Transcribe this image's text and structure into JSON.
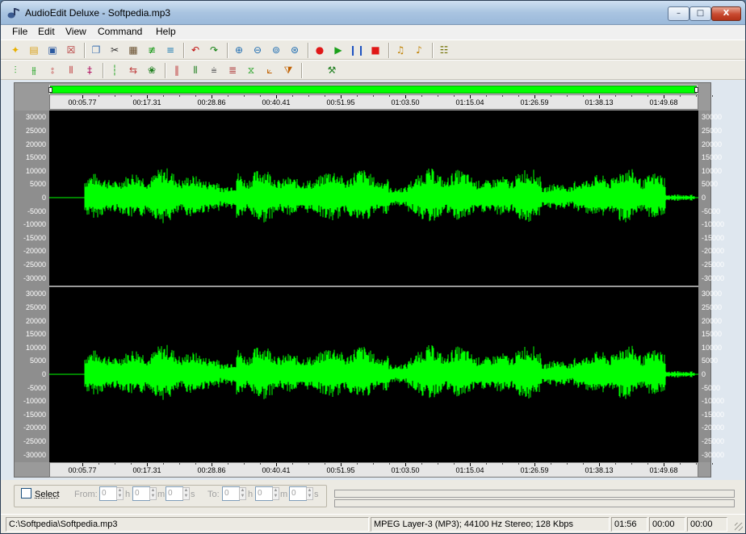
{
  "window": {
    "title": "AudioEdit Deluxe  -  Softpedia.mp3",
    "controls": {
      "minimize": "–",
      "maximize": "□",
      "close": "X"
    }
  },
  "menubar": [
    "File",
    "Edit",
    "View",
    "Command",
    "Help"
  ],
  "toolbar_main": [
    {
      "name": "new-file-icon",
      "glyph": "✦",
      "color": "#e8b000"
    },
    {
      "name": "open-file-icon",
      "glyph": "▤",
      "color": "#d9a21b"
    },
    {
      "name": "save-icon",
      "glyph": "▣",
      "color": "#2c5aa0"
    },
    {
      "name": "close-file-icon",
      "glyph": "☒",
      "color": "#b02a2a"
    },
    {
      "name": "copy-icon",
      "glyph": "❐",
      "color": "#3a6fb0"
    },
    {
      "name": "cut-icon",
      "glyph": "✂",
      "color": "#333333"
    },
    {
      "name": "paste-icon",
      "glyph": "▦",
      "color": "#6a5030"
    },
    {
      "name": "trim-icon",
      "glyph": "≢",
      "color": "#1a9a1a"
    },
    {
      "name": "mix-icon",
      "glyph": "≡",
      "color": "#1a7ab0"
    },
    {
      "name": "undo-icon",
      "glyph": "↶",
      "color": "#c01010"
    },
    {
      "name": "redo-icon",
      "glyph": "↷",
      "color": "#108010"
    },
    {
      "name": "zoom-in-icon",
      "glyph": "⊕",
      "color": "#1a6ab0"
    },
    {
      "name": "zoom-out-icon",
      "glyph": "⊖",
      "color": "#1a6ab0"
    },
    {
      "name": "zoom-selection-icon",
      "glyph": "⊚",
      "color": "#1a6ab0"
    },
    {
      "name": "zoom-all-icon",
      "glyph": "⊛",
      "color": "#1a6ab0"
    },
    {
      "name": "record-icon",
      "glyph": "●",
      "color": "#e01818"
    },
    {
      "name": "play-icon",
      "glyph": "▶",
      "color": "#1aa01a"
    },
    {
      "name": "pause-icon",
      "glyph": "❙❙",
      "color": "#1a50c0"
    },
    {
      "name": "stop-icon",
      "glyph": "■",
      "color": "#e01818"
    },
    {
      "name": "volume-icon",
      "glyph": "♫",
      "color": "#c08000"
    },
    {
      "name": "volume-settings-icon",
      "glyph": "♪",
      "color": "#c08000"
    },
    {
      "name": "options-icon",
      "glyph": "☷",
      "color": "#707000"
    }
  ],
  "toolbar_effects": [
    {
      "name": "fade-in-icon",
      "glyph": "⫶",
      "color": "#1aa01a"
    },
    {
      "name": "fade-out-icon",
      "glyph": "⫵",
      "color": "#1aa01a"
    },
    {
      "name": "amplify-icon",
      "glyph": "⦂",
      "color": "#c04040"
    },
    {
      "name": "normalize-icon",
      "glyph": "⦀",
      "color": "#c04040"
    },
    {
      "name": "echo-icon",
      "glyph": "‡",
      "color": "#b01060"
    },
    {
      "name": "silence-icon",
      "glyph": "┆",
      "color": "#1aa01a"
    },
    {
      "name": "reverse-icon",
      "glyph": "⇆",
      "color": "#c04040"
    },
    {
      "name": "noise-reduction-icon",
      "glyph": "❀",
      "color": "#208020"
    },
    {
      "name": "insert-silence-icon",
      "glyph": "‖",
      "color": "#c04040"
    },
    {
      "name": "insert-noise-icon",
      "glyph": "⦀",
      "color": "#208020"
    },
    {
      "name": "flanger-icon",
      "glyph": "⩧",
      "color": "#707070"
    },
    {
      "name": "chorus-icon",
      "glyph": "≣",
      "color": "#b04040"
    },
    {
      "name": "equalizer-icon",
      "glyph": "⧖",
      "color": "#20a020"
    },
    {
      "name": "pitch-icon",
      "glyph": "⟀",
      "color": "#c06000"
    },
    {
      "name": "tempo-icon",
      "glyph": "⧩",
      "color": "#c06000"
    },
    {
      "name": "stereo-icon",
      "glyph": " ",
      "color": "#c04040"
    },
    {
      "name": "convert-icon",
      "glyph": "⚒",
      "color": "#208020"
    }
  ],
  "waveform": {
    "selection_bar_color": "#00ff00",
    "wave_color": "#00ff00",
    "timeline_labels": [
      "00:05.77",
      "00:17.31",
      "00:28.86",
      "00:40.41",
      "00:51.95",
      "01:03.50",
      "01:15.04",
      "01:26.59",
      "01:38.13",
      "01:49.68"
    ],
    "amplitude_labels": [
      "30000",
      "25000",
      "20000",
      "15000",
      "10000",
      "5000",
      "0",
      "-5000",
      "-10000",
      "-15000",
      "-20000",
      "-25000",
      "-30000"
    ],
    "channels": 2
  },
  "selection": {
    "checkbox_label": "Select",
    "checked": false,
    "from_label": "From:",
    "to_label": "To:",
    "from": {
      "h": "0",
      "m": "0",
      "s": "0"
    },
    "to": {
      "h": "0",
      "m": "0",
      "s": "0"
    },
    "unit_h": "h",
    "unit_m": "m",
    "unit_s": "s"
  },
  "statusbar": {
    "path": "C:\\Softpedia\\Softpedia.mp3",
    "format": "MPEG Layer-3 (MP3); 44100 Hz Stereo; 128 Kbps",
    "duration": "01:56",
    "pos1": "00:00",
    "pos2": "00:00"
  }
}
